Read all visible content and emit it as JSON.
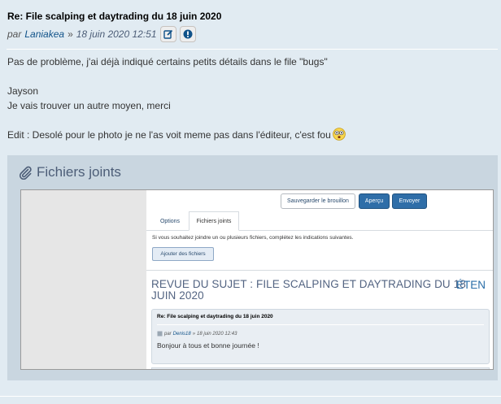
{
  "post": {
    "title": "Re: File scalping et daytrading du 18 juin 2020",
    "by": "par",
    "author": "Laniakea",
    "separator": "»",
    "date": "18 juin 2020 12:51",
    "edit_icon": "edit-icon",
    "report_icon": "report-icon"
  },
  "content": {
    "line1": "Pas de problème, j'ai déjà indiqué certains petits détails dans le file \"bugs\"",
    "line2": "Jayson",
    "line3": "Je vais trouver un autre moyen, merci",
    "line4": "Edit : Desolé pour le photo je ne l'as voit meme pas dans l'éditeur, c'est fou",
    "emoji": "eek-smiley-icon"
  },
  "attachments": {
    "heading": "Fichiers joints",
    "icon": "paperclip-icon",
    "screenshot": {
      "buttons": {
        "draft": "Sauvegarder le brouillon",
        "preview": "Aperçu",
        "send": "Envoyer"
      },
      "tabs": [
        "Options",
        "Fichiers joints"
      ],
      "hint": "Si vous souhaitez joindre un ou plusieurs fichiers, complétez les indications suivantes.",
      "add_files": "Ajouter des fichiers",
      "review_title": "REVUE DU SUJET : FILE SCALPING ET DAYTRADING DU 18 JUIN 2020",
      "expand": "ÉTEN",
      "quoted_post": {
        "title": "Re: File scalping et daytrading du 18 juin 2020",
        "by": "par",
        "author": "Denis18",
        "separator": "»",
        "date": "18 juin 2020 12:43",
        "body": "Bonjour à tous et bonne journée !"
      }
    }
  },
  "colors": {
    "background": "#e1ebf2",
    "link": "#105289",
    "accent_button": "#2f6ea8",
    "attach_box": "#c9d6e0"
  }
}
